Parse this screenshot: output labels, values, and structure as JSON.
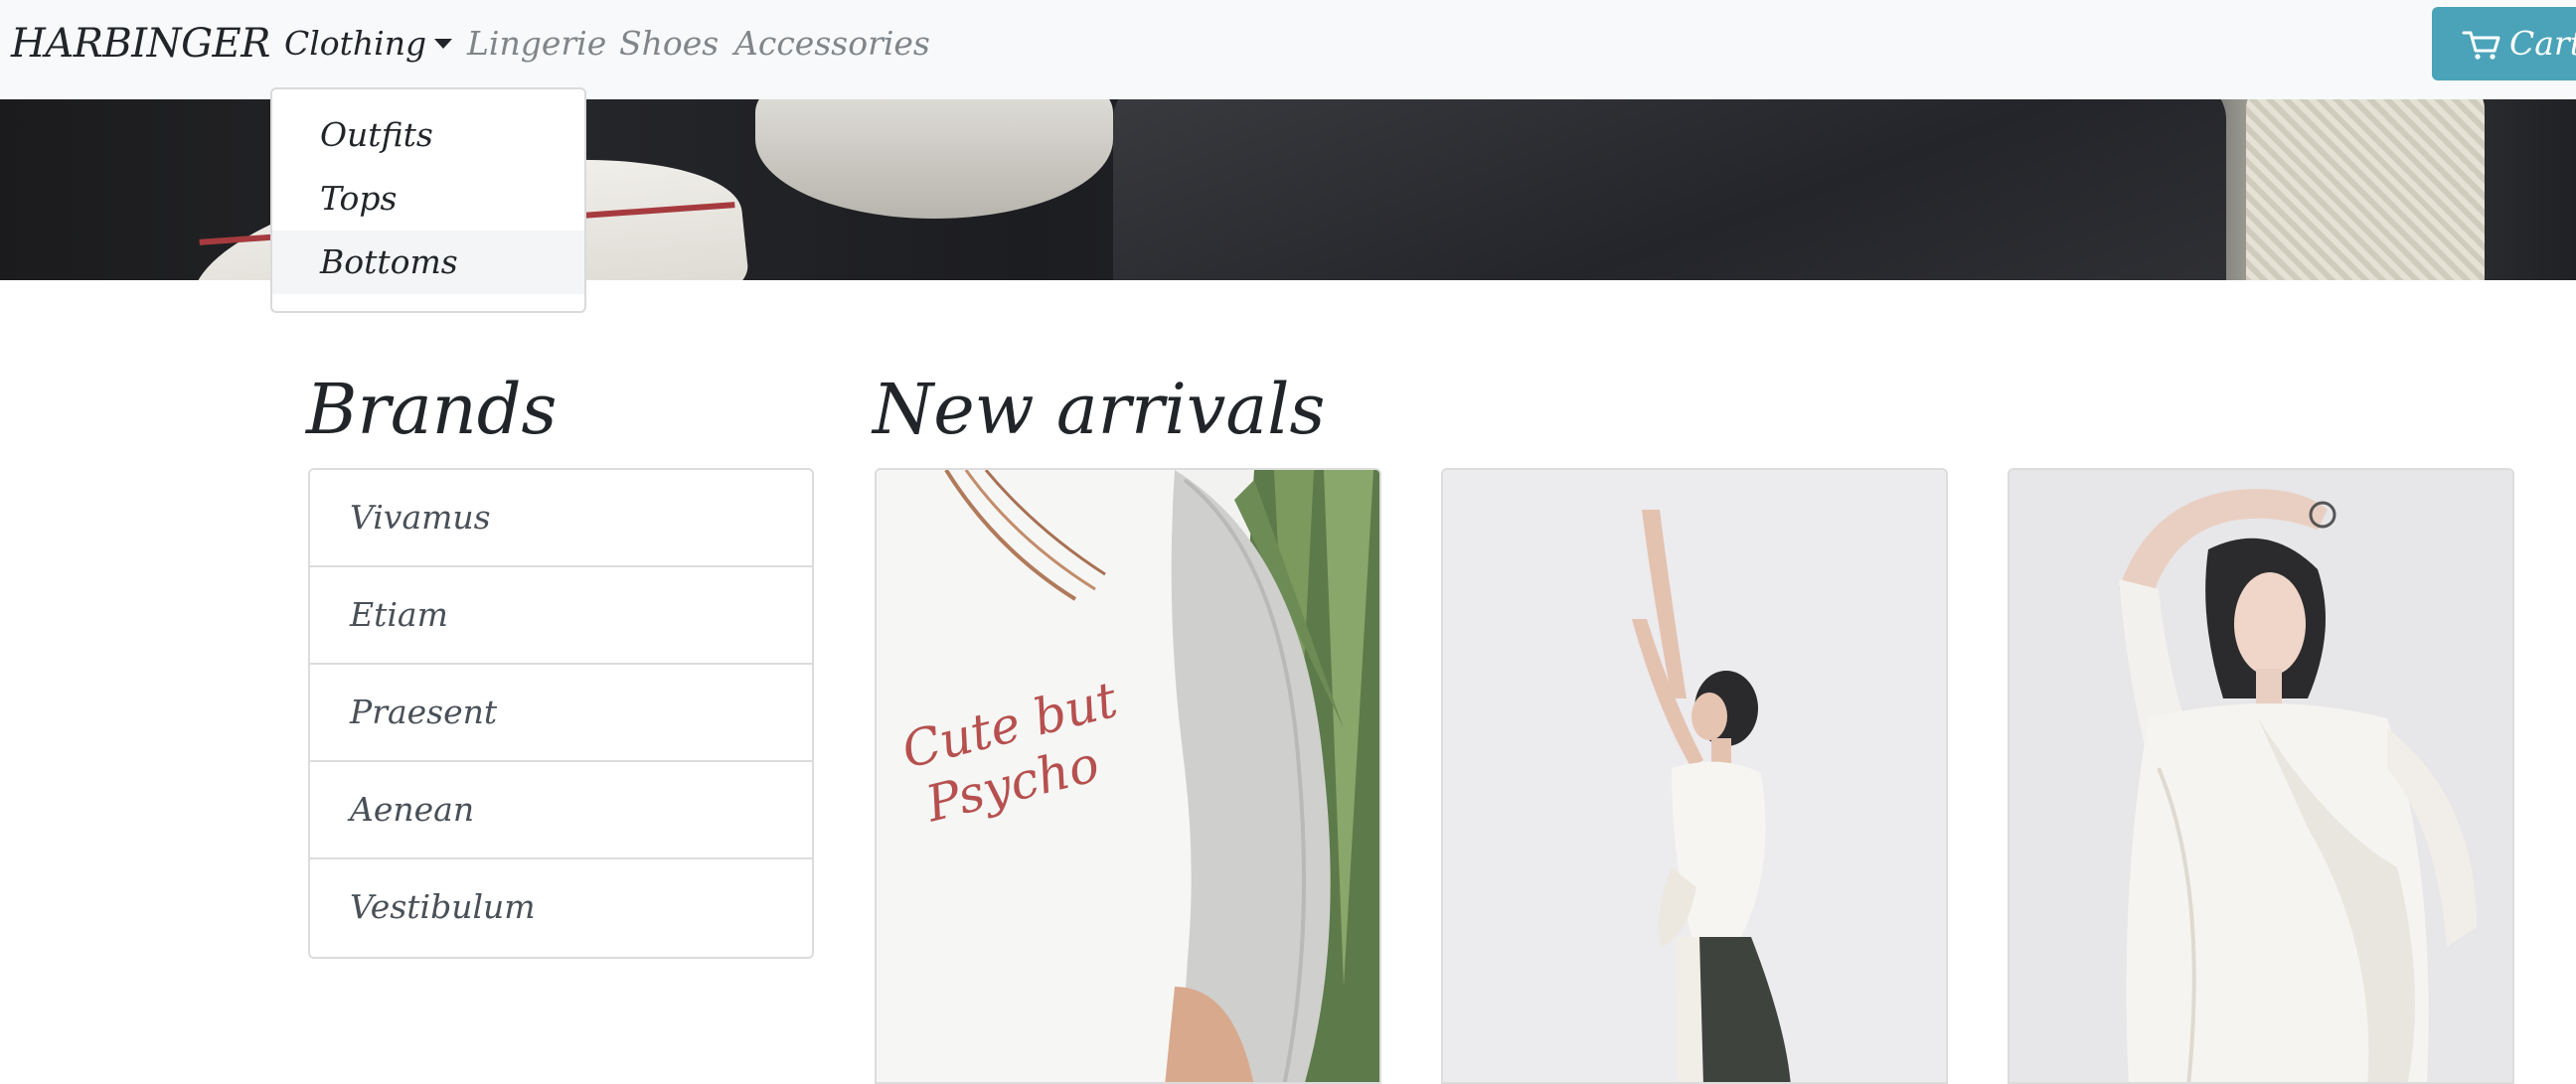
{
  "navbar": {
    "brand": "HARBINGER",
    "items": [
      {
        "label": "Clothing",
        "active": true
      },
      {
        "label": "Lingerie",
        "active": false
      },
      {
        "label": "Shoes",
        "active": false
      },
      {
        "label": "Accessories",
        "active": false
      }
    ],
    "cart_label": "Cart",
    "cart_color": "#4aa3b8"
  },
  "dropdown": {
    "items": [
      "Outfits",
      "Tops",
      "Bottoms"
    ],
    "hovered": "Bottoms"
  },
  "brands": {
    "title": "Brands",
    "items": [
      "Vivamus",
      "Etiam",
      "Praesent",
      "Aenean",
      "Vestibulum"
    ]
  },
  "new_arrivals": {
    "title": "New arrivals",
    "products": [
      {
        "image": "white-sweatshirt-photo",
        "embroidery_line1": "Cute but",
        "embroidery_line2": "Psycho"
      },
      {
        "image": "woman-arms-raised-photo"
      },
      {
        "image": "woman-white-draped-top-photo"
      }
    ]
  }
}
